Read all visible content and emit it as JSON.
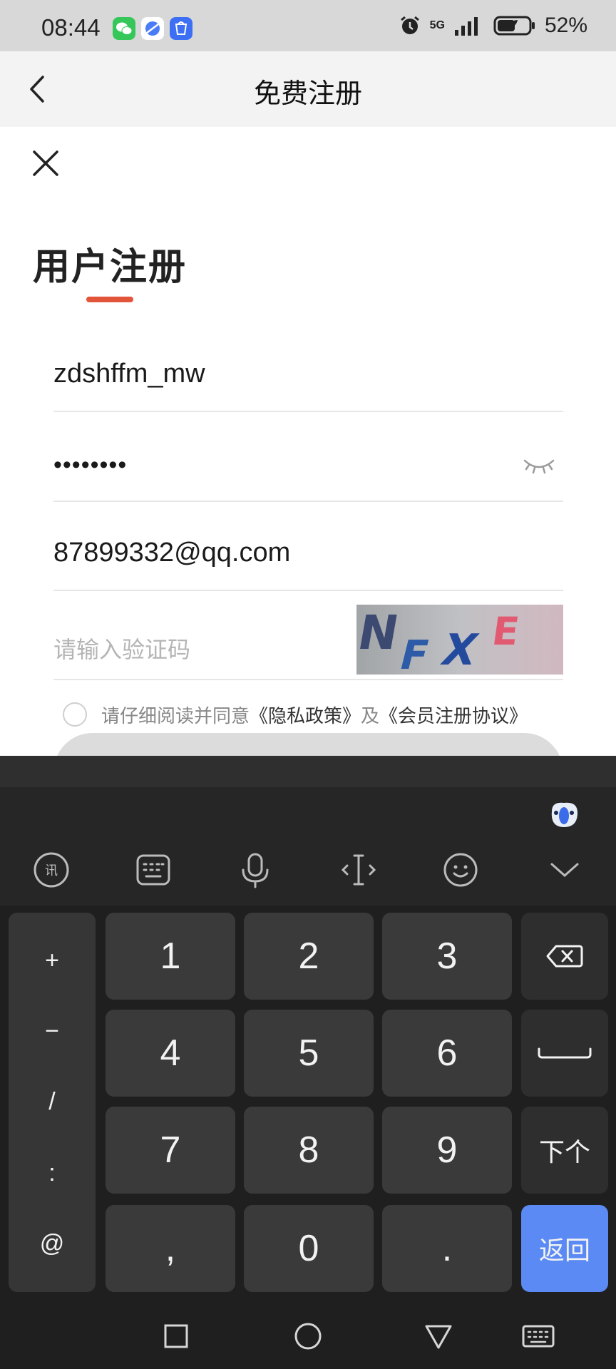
{
  "status_bar": {
    "time": "08:44",
    "network": "5G",
    "battery": "52%",
    "apps": [
      "wechat-icon",
      "browser-icon",
      "app-market-icon"
    ]
  },
  "header": {
    "title": "免费注册"
  },
  "form": {
    "title": "用户注册",
    "username": "zdshffm_mw",
    "password_masked": "••••••••",
    "email": "87899332@qq.com",
    "captcha_placeholder": "请输入验证码",
    "captcha_image_text": "NFXE",
    "agree_prefix": "请仔细阅读并同意",
    "privacy_link": "《隐私政策》",
    "agree_and": "及",
    "member_link": "《会员注册协议》"
  },
  "keyboard": {
    "symbols": [
      "+",
      "−",
      "/",
      ":",
      "@"
    ],
    "digits": [
      "1",
      "2",
      "3",
      "4",
      "5",
      "6",
      "7",
      "8",
      "9",
      "0"
    ],
    "comma": ",",
    "period": ".",
    "next_label": "下个",
    "return_label": "返回"
  },
  "colors": {
    "accent_underline": "#e2553a",
    "return_key": "#5b8af5",
    "keyboard_bg": "#262626"
  }
}
